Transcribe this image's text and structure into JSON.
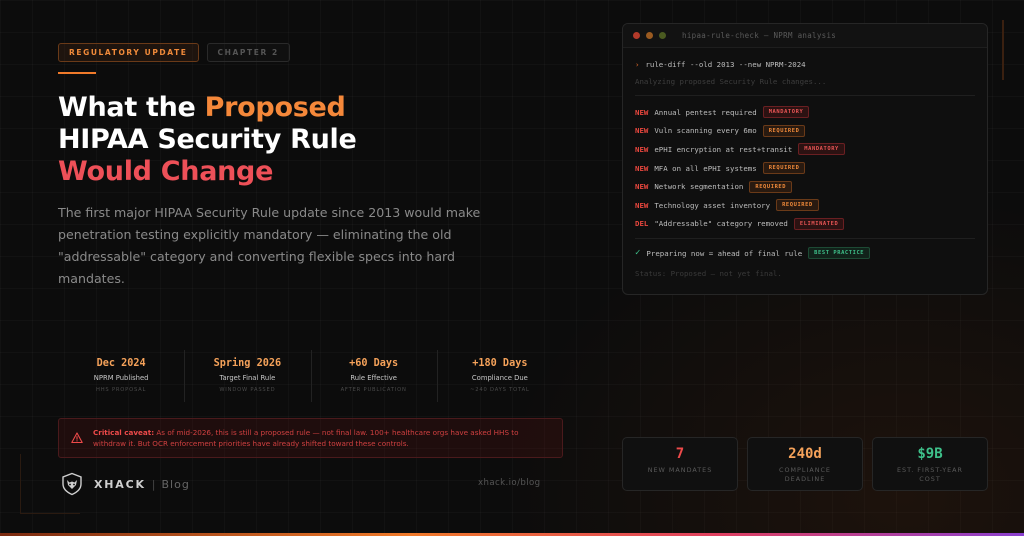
{
  "tags": {
    "primary": "REGULATORY UPDATE",
    "secondary": "CHAPTER 2"
  },
  "headline": {
    "part1": "What the ",
    "part2": "Proposed",
    "part3": "HIPAA Security Rule",
    "part4": "Would Change"
  },
  "lede": "The first major HIPAA Security Rule update since 2013 would make penetration testing explicitly mandatory — eliminating the old \"addressable\" category and converting flexible specs into hard mandates.",
  "timeline": [
    {
      "date": "Dec 2024",
      "label": "NPRM Published",
      "sub": "HHS PROPOSAL"
    },
    {
      "date": "Spring 2026",
      "label": "Target Final Rule",
      "sub": "WINDOW PASSED"
    },
    {
      "date": "+60 Days",
      "label": "Rule Effective",
      "sub": "AFTER PUBLICATION"
    },
    {
      "date": "+180 Days",
      "label": "Compliance Due",
      "sub": "~240 DAYS TOTAL"
    }
  ],
  "caveat": {
    "lead": "Critical caveat:",
    "text": " As of mid-2026, this is still a proposed rule — not final law. 100+ healthcare orgs have asked HHS to withdraw it. But OCR enforcement priorities have already shifted toward these controls."
  },
  "brand": {
    "name": "XHACK",
    "separator": "|",
    "section": "Blog",
    "url": "xhack.io/blog"
  },
  "terminal": {
    "title": "hipaa-rule-check — NPRM analysis",
    "prompt": "›",
    "command": "rule-diff --old 2013 --new NPRM-2024",
    "analyzing": "Analyzing proposed Security Rule changes...",
    "rows": [
      {
        "kind": "NEW",
        "text": "Annual pentest required",
        "badge": "MANDATORY"
      },
      {
        "kind": "NEW",
        "text": "Vuln scanning every 6mo",
        "badge": "REQUIRED"
      },
      {
        "kind": "NEW",
        "text": "ePHI encryption at rest+transit",
        "badge": "MANDATORY"
      },
      {
        "kind": "NEW",
        "text": "MFA on all ePHI systems",
        "badge": "REQUIRED"
      },
      {
        "kind": "NEW",
        "text": "Network segmentation",
        "badge": "REQUIRED"
      },
      {
        "kind": "NEW",
        "text": "Technology asset inventory",
        "badge": "REQUIRED"
      },
      {
        "kind": "DEL",
        "text": "\"Addressable\" category removed",
        "badge": "ELIMINATED"
      }
    ],
    "ok_check": "✓",
    "ok_text": "Preparing now = ahead of final rule",
    "ok_badge": "BEST PRACTICE",
    "status": "Status: Proposed — not yet final."
  },
  "stats": [
    {
      "value": "7",
      "label1": "NEW MANDATES",
      "label2": ""
    },
    {
      "value": "240d",
      "label1": "COMPLIANCE",
      "label2": "DEADLINE"
    },
    {
      "value": "$9B",
      "label1": "EST. FIRST-YEAR",
      "label2": "COST"
    }
  ],
  "colors": {
    "accent": "#f07a2a",
    "danger": "#ee4a4a",
    "success": "#3ec08a",
    "background": "#0c0c0c"
  }
}
